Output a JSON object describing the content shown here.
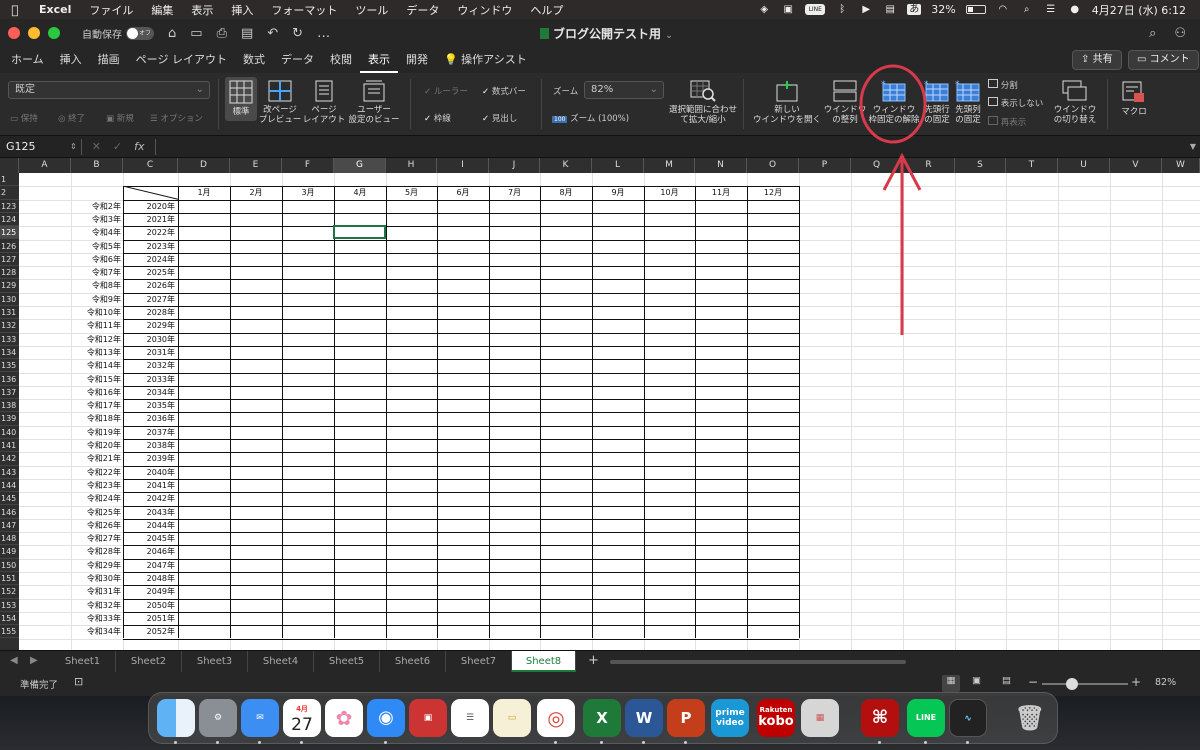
{
  "menubar": {
    "app_name": "Excel",
    "items": [
      "ファイル",
      "編集",
      "表示",
      "挿入",
      "フォーマット",
      "ツール",
      "データ",
      "ウィンドウ",
      "ヘルプ"
    ],
    "battery": "32%",
    "datetime": "4月27日 (水)  6:12",
    "ime": "あ",
    "line_badge": "LINE"
  },
  "titlebar": {
    "autosave_label": "自動保存",
    "autosave_state": "オフ",
    "document_title": "ブログ公開テスト用",
    "quick_access": [
      "home-icon",
      "save-icon",
      "print-icon",
      "save-as-icon",
      "undo-icon",
      "redo-icon",
      "more-icon"
    ],
    "more": "…"
  },
  "ribbon_tabs": {
    "tabs": [
      "ホーム",
      "挿入",
      "描画",
      "ページ レイアウト",
      "数式",
      "データ",
      "校閲",
      "表示",
      "開発"
    ],
    "active": "表示",
    "assist": "操作アシスト",
    "share": "共有",
    "comment": "コメント"
  },
  "ribbon": {
    "view_combo": "既定",
    "view_small": [
      "保持",
      "終了",
      "新規",
      "オプション"
    ],
    "normal": "標準",
    "page_break": [
      "改ページ",
      "プレビュー"
    ],
    "page_layout": [
      "ページ",
      "レイアウト"
    ],
    "custom_view": [
      "ユーザー",
      "設定のビュー"
    ],
    "ruler": "ルーラー",
    "formula_bar": "数式バー",
    "gridlines": "枠線",
    "headings": "見出し",
    "zoom_label": "ズーム",
    "zoom_value": "82%",
    "zoom_100": "ズーム (100%)",
    "zoom_100_icon": "100",
    "zoom_selection": [
      "選択範囲に合わせ",
      "て拡大/縮小"
    ],
    "new_window": [
      "新しい",
      "ウインドウを開く"
    ],
    "arrange": [
      "ウインドウ",
      "の整列"
    ],
    "unfreeze": [
      "ウィンドウ",
      "枠固定の解除"
    ],
    "freeze_top": [
      "先頭行",
      "の固定"
    ],
    "freeze_first_col": [
      "先頭列",
      "の固定"
    ],
    "split": "分割",
    "hide": "表示しない",
    "unhide": "再表示",
    "switch_window": [
      "ウインドウ",
      "の切り替え"
    ],
    "macro": "マクロ"
  },
  "formula_bar": {
    "name_box": "G125",
    "fx": "fx"
  },
  "columns": [
    "A",
    "B",
    "C",
    "D",
    "E",
    "F",
    "G",
    "H",
    "I",
    "J",
    "K",
    "L",
    "M",
    "N",
    "O",
    "P",
    "Q",
    "R",
    "S",
    "T",
    "U",
    "V",
    "W"
  ],
  "selected_column": "G",
  "selected_row": "125",
  "month_headers": [
    "1月",
    "2月",
    "3月",
    "4月",
    "5月",
    "6月",
    "7月",
    "8月",
    "9月",
    "10月",
    "11月",
    "12月"
  ],
  "rows": [
    {
      "num": "1",
      "era": "",
      "year": ""
    },
    {
      "num": "2",
      "era": "",
      "year": ""
    },
    {
      "num": "123",
      "era": "令和2年",
      "year": "2020年"
    },
    {
      "num": "124",
      "era": "令和3年",
      "year": "2021年"
    },
    {
      "num": "125",
      "era": "令和4年",
      "year": "2022年"
    },
    {
      "num": "126",
      "era": "令和5年",
      "year": "2023年"
    },
    {
      "num": "127",
      "era": "令和6年",
      "year": "2024年"
    },
    {
      "num": "128",
      "era": "令和7年",
      "year": "2025年"
    },
    {
      "num": "129",
      "era": "令和8年",
      "year": "2026年"
    },
    {
      "num": "130",
      "era": "令和9年",
      "year": "2027年"
    },
    {
      "num": "131",
      "era": "令和10年",
      "year": "2028年"
    },
    {
      "num": "132",
      "era": "令和11年",
      "year": "2029年"
    },
    {
      "num": "133",
      "era": "令和12年",
      "year": "2030年"
    },
    {
      "num": "134",
      "era": "令和13年",
      "year": "2031年"
    },
    {
      "num": "135",
      "era": "令和14年",
      "year": "2032年"
    },
    {
      "num": "136",
      "era": "令和15年",
      "year": "2033年"
    },
    {
      "num": "137",
      "era": "令和16年",
      "year": "2034年"
    },
    {
      "num": "138",
      "era": "令和17年",
      "year": "2035年"
    },
    {
      "num": "139",
      "era": "令和18年",
      "year": "2036年"
    },
    {
      "num": "140",
      "era": "令和19年",
      "year": "2037年"
    },
    {
      "num": "141",
      "era": "令和20年",
      "year": "2038年"
    },
    {
      "num": "142",
      "era": "令和21年",
      "year": "2039年"
    },
    {
      "num": "143",
      "era": "令和22年",
      "year": "2040年"
    },
    {
      "num": "144",
      "era": "令和23年",
      "year": "2041年"
    },
    {
      "num": "145",
      "era": "令和24年",
      "year": "2042年"
    },
    {
      "num": "146",
      "era": "令和25年",
      "year": "2043年"
    },
    {
      "num": "147",
      "era": "令和26年",
      "year": "2044年"
    },
    {
      "num": "148",
      "era": "令和27年",
      "year": "2045年"
    },
    {
      "num": "149",
      "era": "令和28年",
      "year": "2046年"
    },
    {
      "num": "150",
      "era": "令和29年",
      "year": "2047年"
    },
    {
      "num": "151",
      "era": "令和30年",
      "year": "2048年"
    },
    {
      "num": "152",
      "era": "令和31年",
      "year": "2049年"
    },
    {
      "num": "153",
      "era": "令和32年",
      "year": "2050年"
    },
    {
      "num": "154",
      "era": "令和33年",
      "year": "2051年"
    },
    {
      "num": "155",
      "era": "令和34年",
      "year": "2052年"
    }
  ],
  "sheets": [
    "Sheet1",
    "Sheet2",
    "Sheet3",
    "Sheet4",
    "Sheet5",
    "Sheet6",
    "Sheet7",
    "Sheet8"
  ],
  "active_sheet": "Sheet8",
  "add_sheet": "+",
  "status": {
    "ready": "準備完了",
    "zoom": "82%",
    "zoom_level": 0.82,
    "minus": "−",
    "plus": "+"
  },
  "dock": {
    "apps": [
      "finder",
      "system-preferences",
      "mail",
      "calendar",
      "photos",
      "safari",
      "photo-booth",
      "reminders",
      "notes",
      "chrome",
      "excel",
      "word",
      "powerpoint",
      "prime-video",
      "kobo",
      "launchpad",
      "acrobat",
      "line",
      "activity-monitor",
      "trash"
    ],
    "calendar_month": "4月",
    "calendar_day": "27",
    "prime_label": [
      "prime",
      "video"
    ],
    "kobo_label": [
      "Rakuten",
      "kobo"
    ],
    "line_label": "LINE",
    "excel_label": "X",
    "word_label": "W",
    "powerpoint_label": "P"
  },
  "colors": {
    "annotation": "#d93a4a",
    "excel_green": "#1f7a3a",
    "selection": "#217346"
  }
}
